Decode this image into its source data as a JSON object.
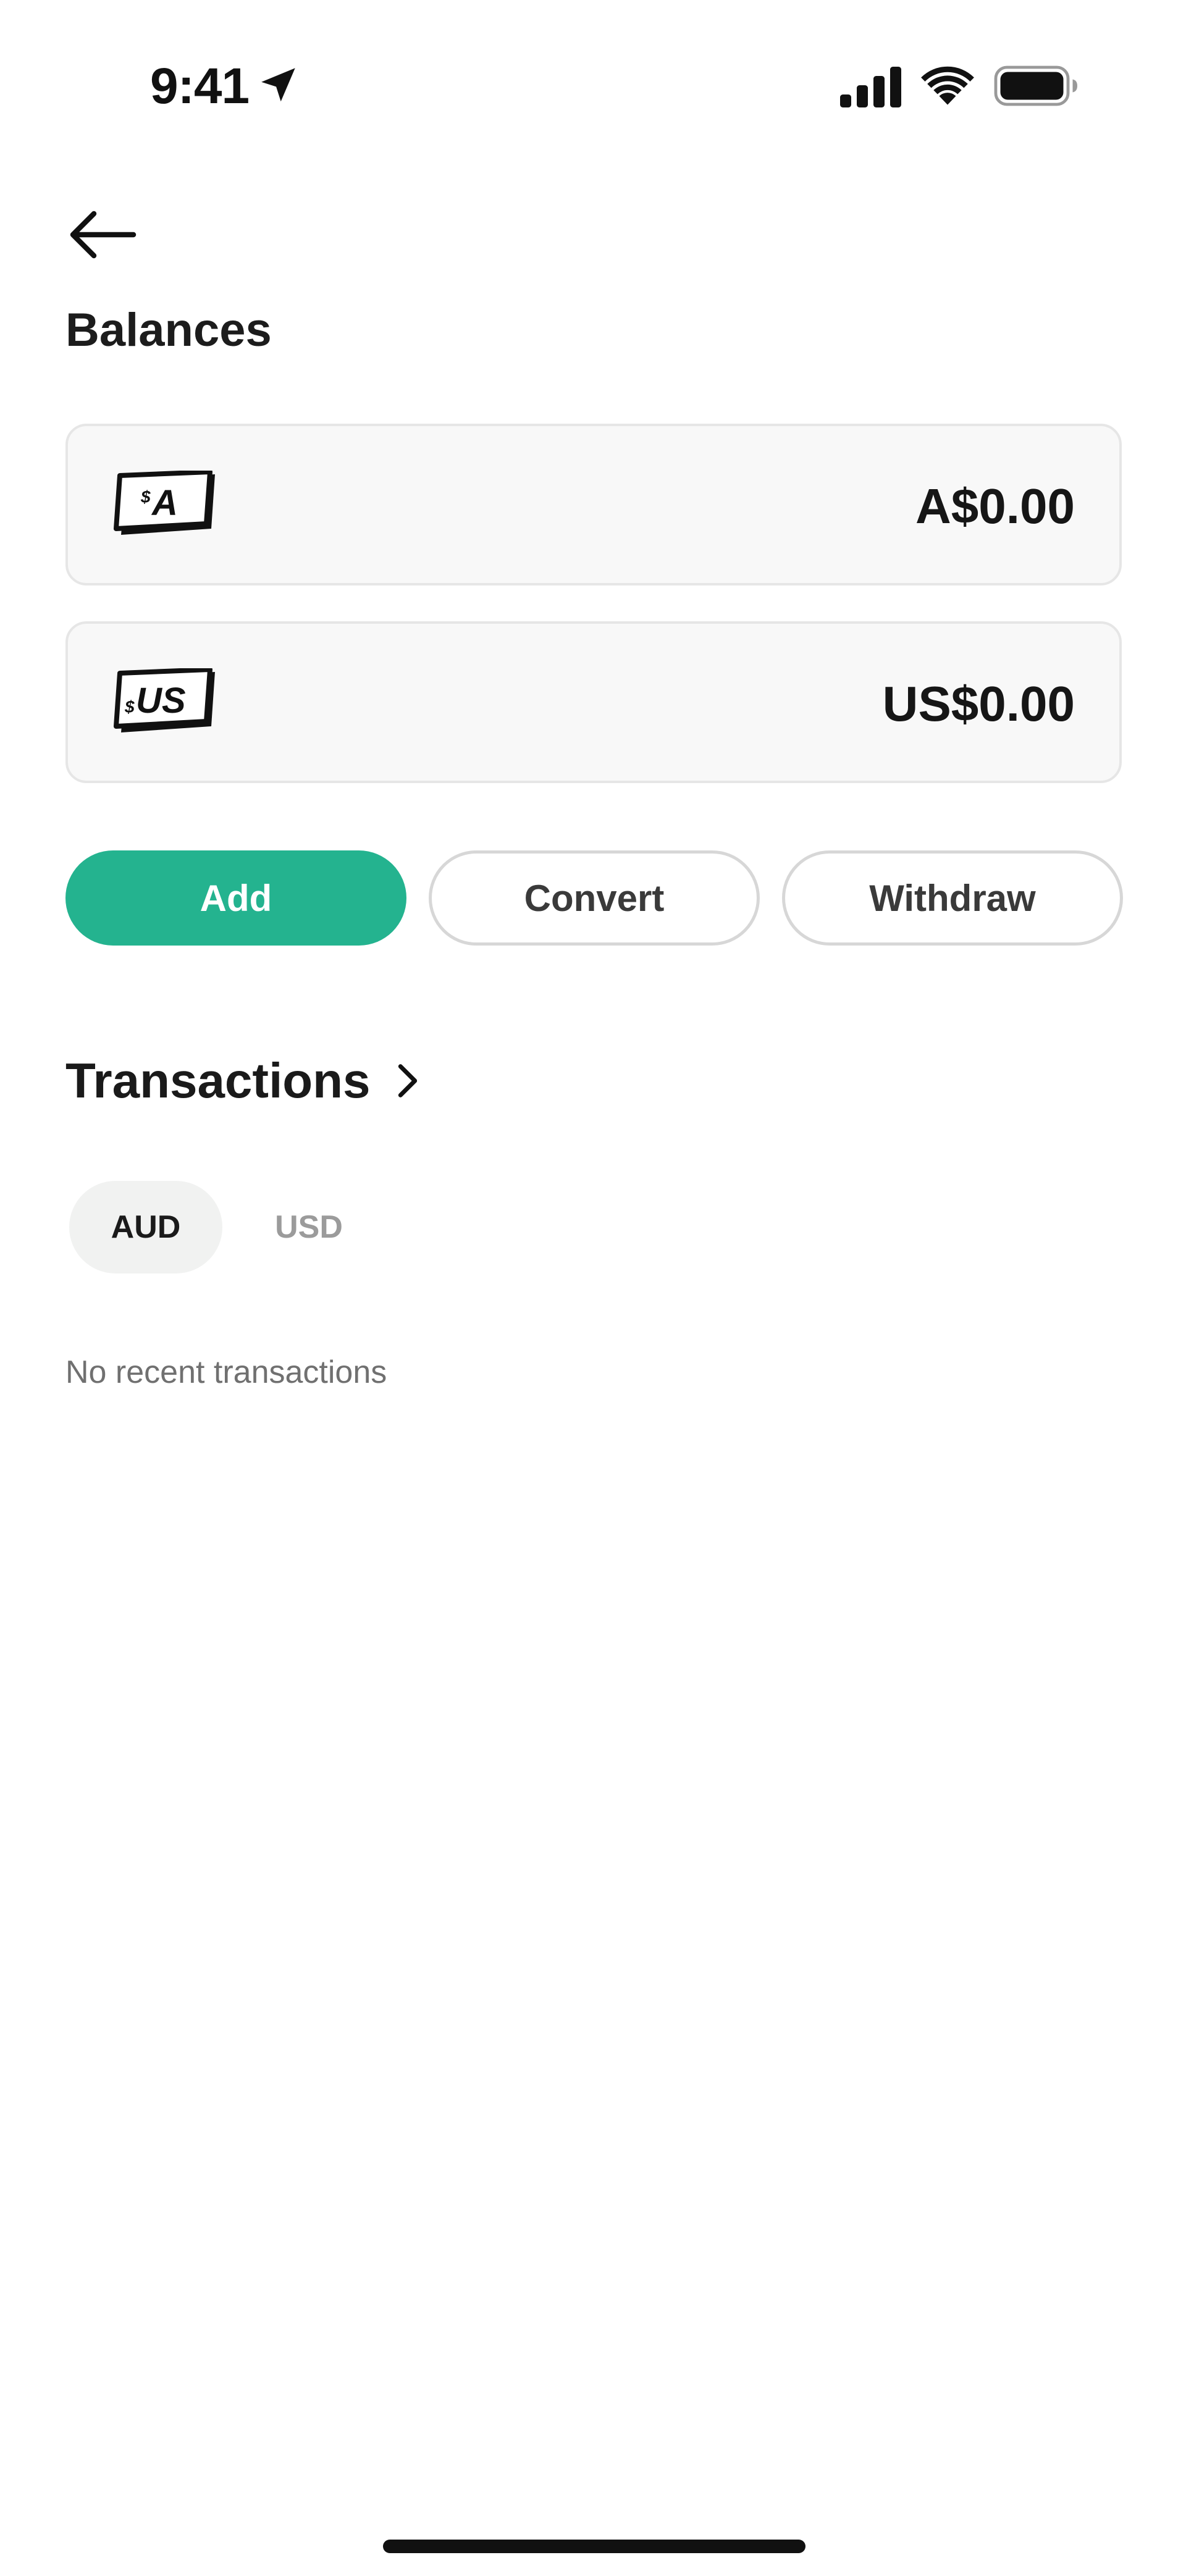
{
  "status_bar": {
    "time": "9:41",
    "icons": [
      "location-arrow-icon",
      "cellular-signal-icon",
      "wifi-icon",
      "battery-icon"
    ]
  },
  "header": {
    "back_icon": "arrow-left-icon",
    "title": "Balances"
  },
  "balances": [
    {
      "currency_icon_text": "A",
      "currency_icon_symbol": "$",
      "amount": "A$0.00"
    },
    {
      "currency_icon_text": "US",
      "currency_icon_symbol": "$",
      "amount": "US$0.00"
    }
  ],
  "actions": {
    "add": "Add",
    "convert": "Convert",
    "withdraw": "Withdraw"
  },
  "transactions": {
    "title": "Transactions",
    "chevron_icon": "chevron-right-icon",
    "tabs": [
      {
        "label": "AUD",
        "selected": true
      },
      {
        "label": "USD",
        "selected": false
      }
    ],
    "empty_message": "No recent transactions"
  },
  "colors": {
    "accent": "#24b38f",
    "card_background": "#f8f8f8",
    "card_border": "#e6e6e6",
    "button_border": "#d7d7d7",
    "tab_selected_background": "#f1f2f1",
    "muted_text": "#707070"
  }
}
